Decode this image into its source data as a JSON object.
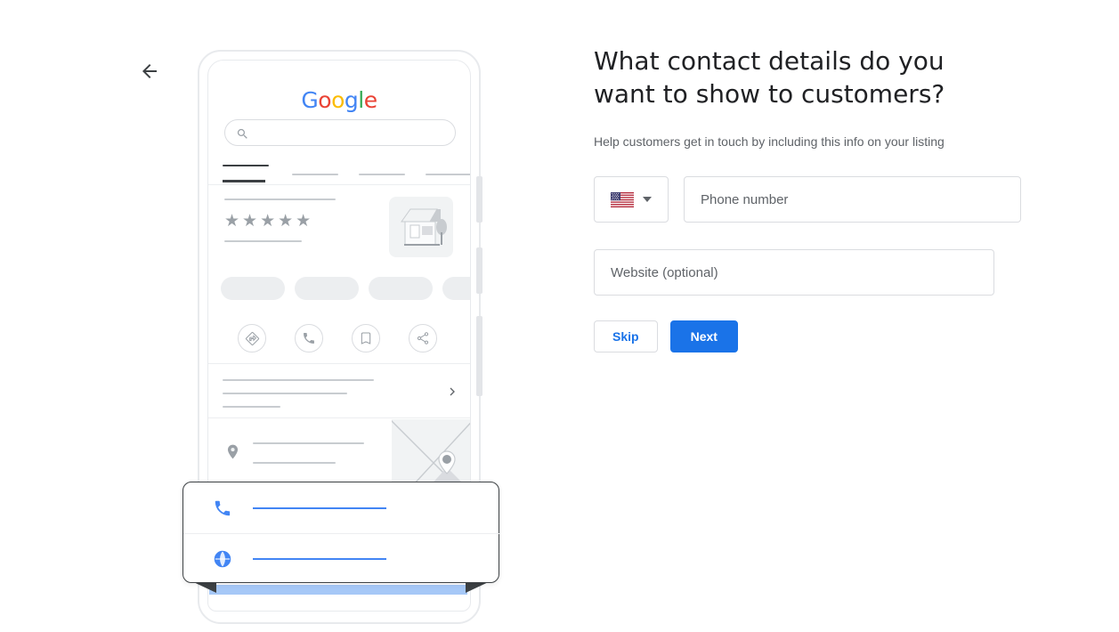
{
  "nav": {
    "back_label": "Back",
    "back_icon": "arrow-left-icon"
  },
  "header": {
    "title": "What contact details do you want to show to customers?",
    "subtitle": "Help customers get in touch by including this info on your listing"
  },
  "form": {
    "country": {
      "selected_flag": "us-flag-icon",
      "caret_icon": "chevron-down-icon"
    },
    "phone": {
      "placeholder": "Phone number",
      "value": ""
    },
    "website": {
      "placeholder": "Website (optional)",
      "value": ""
    }
  },
  "actions": {
    "skip_label": "Skip",
    "next_label": "Next"
  },
  "colors": {
    "accent_blue": "#1a73e8",
    "link_blue": "#1a73e8",
    "overlay_line_blue": "#4285f4",
    "bottom_bar_blue": "#a6c8f7",
    "text_primary": "#202124",
    "text_secondary": "#5f6368",
    "border_gray": "#dadce0",
    "placeholder_gray": "#c8ccd0",
    "chip_gray": "#eceef0"
  },
  "illustration": {
    "logo": {
      "letters": [
        "G",
        "o",
        "o",
        "g",
        "l",
        "e"
      ]
    },
    "search": {
      "icon": "search-icon",
      "value": ""
    },
    "rating": {
      "stars": 5,
      "star_glyph": "★"
    },
    "thumbnail_icon": "storefront-icon",
    "chips_count": 4,
    "action_icons": [
      "directions-icon",
      "phone-icon",
      "bookmark-icon",
      "share-icon"
    ],
    "list_row_icon": "chevron-right-icon",
    "address_icon": "map-pin-icon",
    "map_icon": "map-thumbnail-pin-icon",
    "overlay": {
      "row1_icon": "phone-icon",
      "row2_icon": "globe-icon"
    }
  }
}
